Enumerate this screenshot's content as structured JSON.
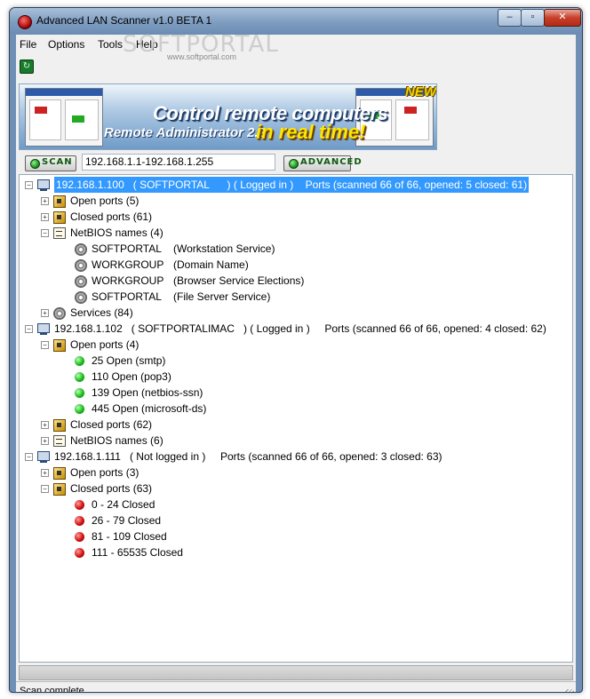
{
  "window": {
    "title": "Advanced LAN Scanner v1.0 BETA 1",
    "controls": {
      "minimize": "–",
      "maximize": "▫",
      "close": "✕"
    }
  },
  "menu": [
    "File",
    "Options",
    "Tools",
    "Help"
  ],
  "watermark": {
    "logo": "SOFTPORTAL",
    "url": "www.softportal.com"
  },
  "toolbar": {
    "refresh_icon": "refresh-icon",
    "refresh_glyph": "↻"
  },
  "banner": {
    "new": "NEW!",
    "headline": "Control remote computers",
    "product": "Remote Administrator 2.2",
    "tagline": "in real time!"
  },
  "controls": {
    "scan_label": "SCAN",
    "range_value": "192.168.1.1-192.168.1.255",
    "advanced_label": "ADVANCED"
  },
  "tree": [
    {
      "kind": "host",
      "text": "192.168.1.100   ( SOFTPORTAL      ) ( Logged in )    Ports (scanned 66 of 66, opened: 5 closed: 61)",
      "selected": true,
      "expander": "−"
    },
    {
      "kind": "ports",
      "text": "Open ports (5)",
      "expander": "+"
    },
    {
      "kind": "ports",
      "text": "Closed ports (61)",
      "expander": "+"
    },
    {
      "kind": "netbios",
      "text": "NetBIOS names (4)",
      "expander": "−"
    },
    {
      "kind": "gear",
      "name": "SOFTPORTAL",
      "desc": "(Workstation Service)"
    },
    {
      "kind": "gear",
      "name": "WORKGROUP",
      "desc": "(Domain Name)"
    },
    {
      "kind": "gear",
      "name": "WORKGROUP",
      "desc": "(Browser Service Elections)"
    },
    {
      "kind": "gear",
      "name": "SOFTPORTAL",
      "desc": "(File Server Service)"
    },
    {
      "kind": "services",
      "text": "Services (84)",
      "expander": "+"
    },
    {
      "kind": "host",
      "text": "192.168.1.102   ( SOFTPORTALIMAC   ) ( Logged in )     Ports (scanned 66 of 66, opened: 4 closed: 62)",
      "selected": false,
      "expander": "−"
    },
    {
      "kind": "ports",
      "text": "Open ports (4)",
      "expander": "−"
    },
    {
      "kind": "open",
      "text": "25 Open (smtp)"
    },
    {
      "kind": "open",
      "text": "110 Open (pop3)"
    },
    {
      "kind": "open",
      "text": "139 Open (netbios-ssn)"
    },
    {
      "kind": "open",
      "text": "445 Open (microsoft-ds)"
    },
    {
      "kind": "ports",
      "text": "Closed ports (62)",
      "expander": "+"
    },
    {
      "kind": "netbios",
      "text": "NetBIOS names (6)",
      "expander": "+"
    },
    {
      "kind": "host",
      "text": "192.168.1.111   ( Not logged in )     Ports (scanned 66 of 66, opened: 3 closed: 63)",
      "selected": false,
      "expander": "−"
    },
    {
      "kind": "ports",
      "text": "Open ports (3)",
      "expander": "+"
    },
    {
      "kind": "ports",
      "text": "Closed ports (63)",
      "expander": "−"
    },
    {
      "kind": "closed",
      "text": "0 - 24 Closed"
    },
    {
      "kind": "closed",
      "text": "26 - 79 Closed"
    },
    {
      "kind": "closed",
      "text": "81 - 109 Closed"
    },
    {
      "kind": "closed",
      "text": "111 - 65535 Closed"
    }
  ],
  "status": {
    "text": "Scan complete"
  },
  "colors": {
    "selection": "#3399ff",
    "open_port": "#1cbd1c",
    "closed_port": "#d41010"
  }
}
